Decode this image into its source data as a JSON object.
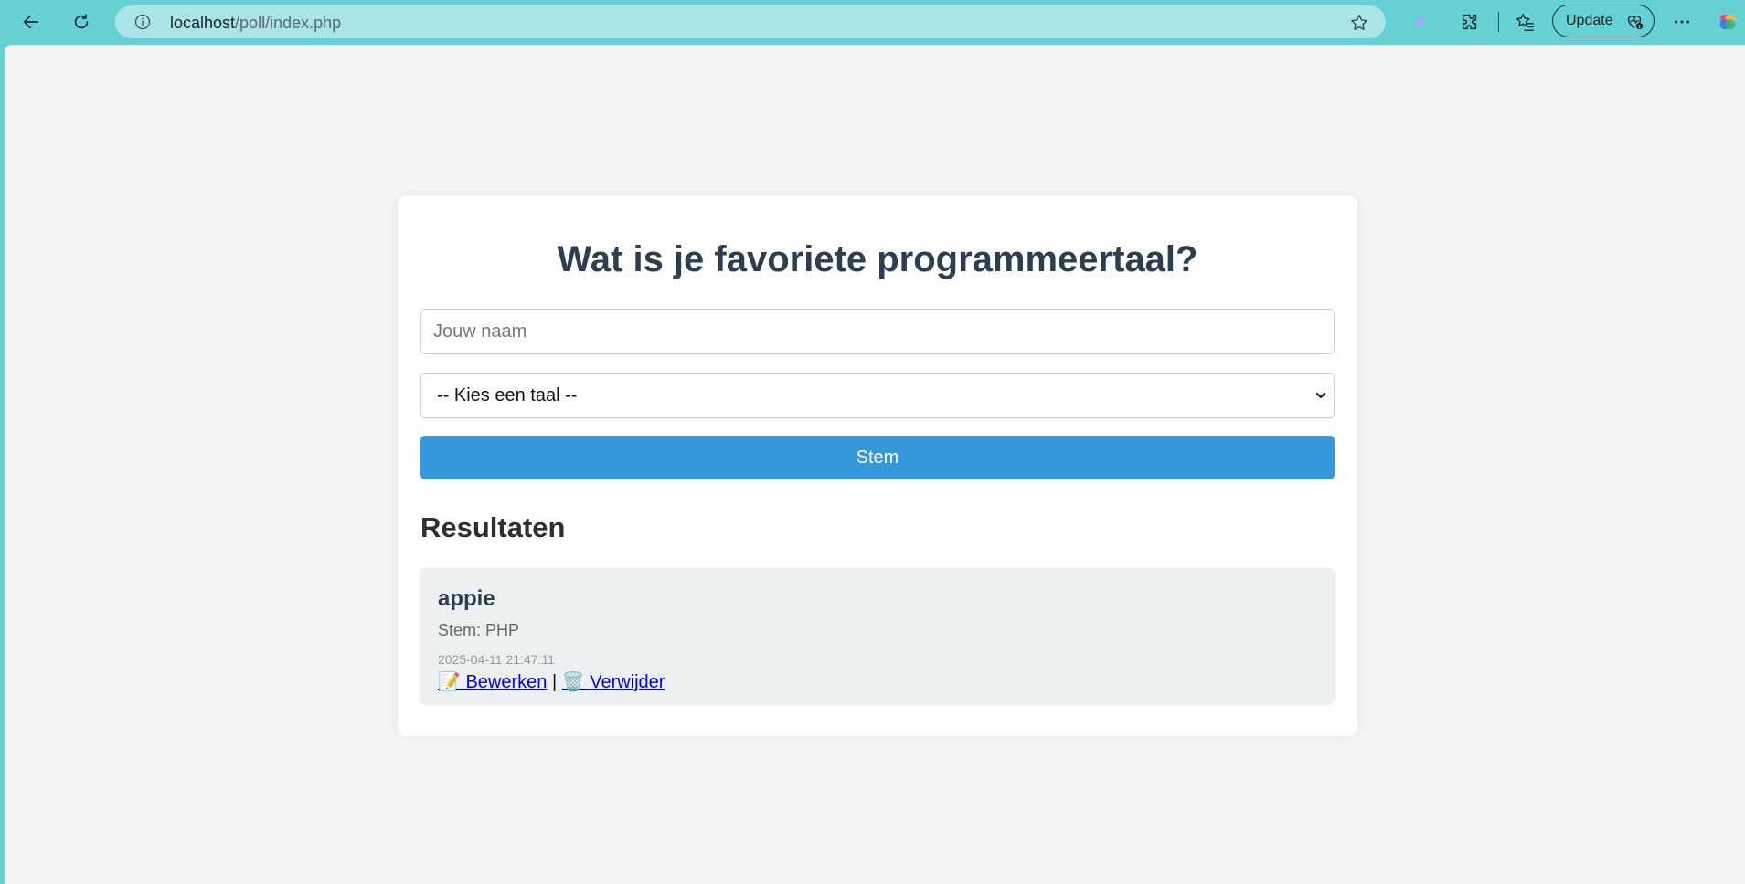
{
  "browser": {
    "url_host": "localhost",
    "url_path": "/poll/index.php",
    "update_label": "Update",
    "icons": [
      "back-arrow-icon",
      "reload-icon",
      "info-icon",
      "star-icon",
      "copilot-icon",
      "extensions-icon",
      "favorites-icon",
      "heart-icon",
      "more-icon",
      "edge-copilot-icon"
    ]
  },
  "poll": {
    "title": "Wat is je favoriete programmeertaal?",
    "name_placeholder": "Jouw naam",
    "select_value": "-- Kies een taal --",
    "submit_label": "Stem"
  },
  "results": {
    "heading": "Resultaten",
    "items": [
      {
        "name": "appie",
        "vote": "Stem: PHP",
        "timestamp": "2025-04-11 21:47:11",
        "edit_label": "Bewerken",
        "edit_emoji": "📝",
        "separator": "|",
        "delete_label": "Verwijder",
        "delete_emoji": "🗑️"
      }
    ]
  },
  "colors": {
    "chrome": "#66d1d4",
    "address_bar": "#a9e5e7",
    "page_bg": "#f4f4f4",
    "primary_button": "#3598db",
    "result_bg": "#ecf0f1",
    "title_color": "#2c3e50"
  }
}
